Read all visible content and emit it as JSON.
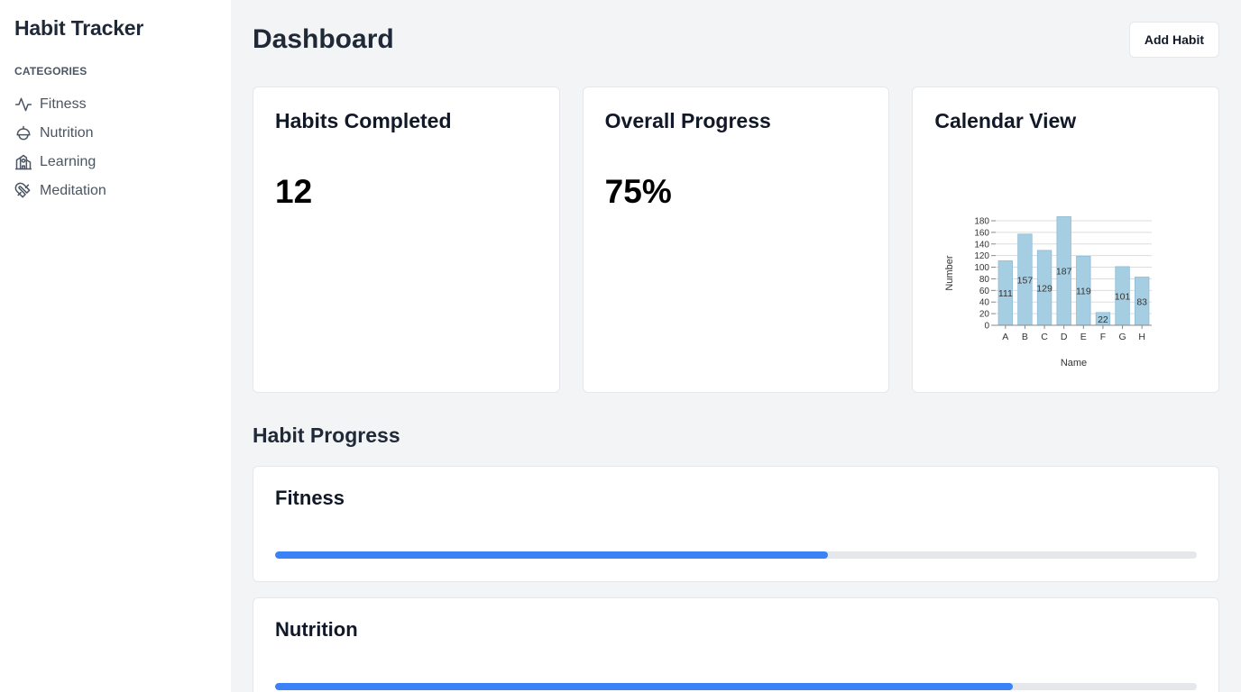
{
  "sidebar": {
    "title": "Habit Tracker",
    "categories_heading": "CATEGORIES",
    "items": [
      {
        "label": "Fitness",
        "icon": "activity-icon"
      },
      {
        "label": "Nutrition",
        "icon": "apple-icon"
      },
      {
        "label": "Learning",
        "icon": "school-icon"
      },
      {
        "label": "Meditation",
        "icon": "magnet-icon"
      }
    ]
  },
  "header": {
    "title": "Dashboard",
    "add_button": "Add Habit"
  },
  "stats": {
    "habits_completed": {
      "title": "Habits Completed",
      "value": "12"
    },
    "overall_progress": {
      "title": "Overall Progress",
      "value": "75%"
    },
    "calendar": {
      "title": "Calendar View"
    }
  },
  "chart_data": {
    "type": "bar",
    "categories": [
      "A",
      "B",
      "C",
      "D",
      "E",
      "F",
      "G",
      "H"
    ],
    "values": [
      111,
      157,
      129,
      187,
      119,
      22,
      101,
      83
    ],
    "xlabel": "Name",
    "ylabel": "Number",
    "ylim": [
      0,
      180
    ],
    "yticks": [
      0,
      20,
      40,
      60,
      80,
      100,
      120,
      140,
      160,
      180
    ],
    "grid": true,
    "bar_color": "#a6cee3"
  },
  "habit_progress": {
    "title": "Habit Progress",
    "items": [
      {
        "label": "Fitness",
        "progress": 0.6
      },
      {
        "label": "Nutrition",
        "progress": 0.8
      }
    ]
  },
  "colors": {
    "accent": "#3b82f6",
    "track": "#e5e7eb"
  }
}
